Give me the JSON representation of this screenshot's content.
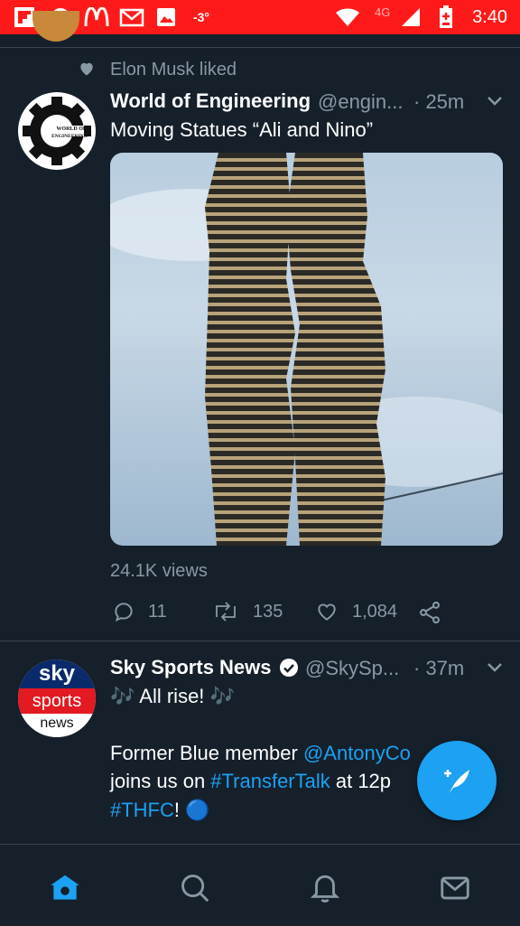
{
  "statusbar": {
    "temperature": "-3°",
    "network": "4G",
    "time": "3:40"
  },
  "tweet1": {
    "social_context": "Elon Musk liked",
    "avatar_text": "WORLD OF ENGINEERING",
    "author_name": "World of Engineering",
    "handle": "@engin...",
    "time": "· 25m",
    "text": "Moving Statues “Ali and Nino”",
    "views": "24.1K views",
    "replies": "11",
    "retweets": "135",
    "likes": "1,084"
  },
  "tweet2": {
    "avatar_line1": "sky",
    "avatar_line2": "sports",
    "avatar_line3": "news",
    "author_name": "Sky Sports News",
    "handle": "@SkySp...",
    "time": "· 37m",
    "line1": "🎶 All rise! 🎶",
    "line2_a": "Former Blue member ",
    "line2_link": "@AntonyCo",
    "line3_a": "joins us on ",
    "line3_link": "#TransferTalk",
    "line3_b": " at 12p",
    "line4_link": "#THFC",
    "line4_b": "! 🔵"
  },
  "colors": {
    "background": "#15202b",
    "accent": "#1da1f2",
    "statusbar": "#ff1a1a",
    "secondary_text": "#8899a6"
  },
  "icons": [
    "flipboard-icon",
    "messenger-icon",
    "mcdonalds-icon",
    "gmail-icon",
    "gallery-icon",
    "wifi-icon",
    "signal-icon",
    "battery-icon",
    "heart-icon",
    "chevron-down-icon",
    "reply-icon",
    "retweet-icon",
    "like-icon",
    "share-icon",
    "verified-icon",
    "compose-tweet-icon",
    "home-icon",
    "search-icon",
    "notifications-icon",
    "messages-icon"
  ]
}
